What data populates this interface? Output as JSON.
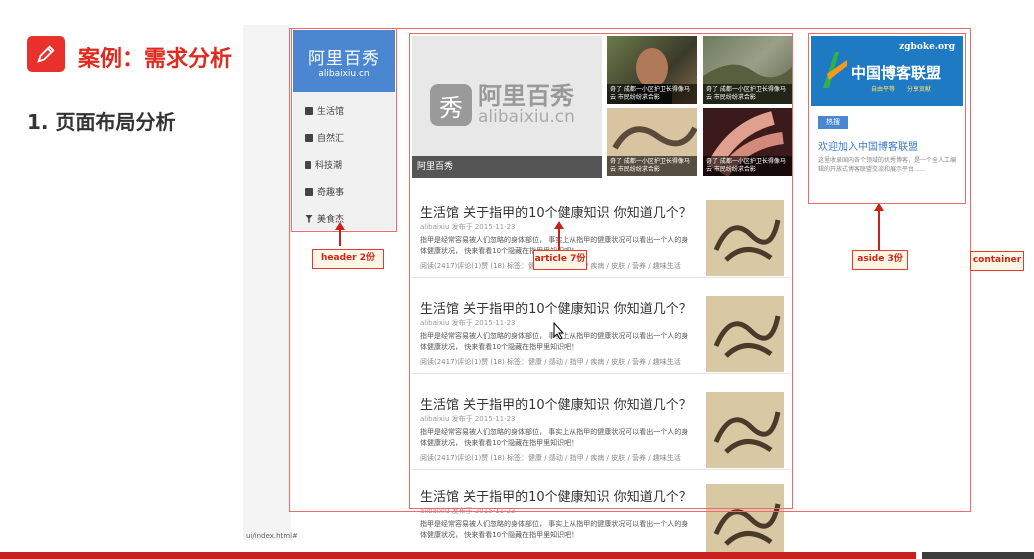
{
  "slide": {
    "case_title": "案例：需求分析",
    "sub_title": "1. 页面布局分析",
    "status_url": "ui/index.html#"
  },
  "colors": {
    "brand_red": "#c8211b",
    "frame_red": "#ef6a6a",
    "header_blue": "#4a87d0"
  },
  "header": {
    "logo_cn": "阿里百秀",
    "logo_en": "alibaixiu.cn",
    "nav": [
      {
        "label": "生活馆",
        "icon": "home-icon"
      },
      {
        "label": "自然汇",
        "icon": "image-icon"
      },
      {
        "label": "科技潮",
        "icon": "phone-icon"
      },
      {
        "label": "奇趣事",
        "icon": "grid-icon"
      },
      {
        "label": "美食杰",
        "icon": "cup-icon"
      }
    ]
  },
  "banner": {
    "mark": "秀",
    "name_cn": "阿里百秀",
    "name_en": "alibaixiu.cn",
    "caption": "阿里百秀"
  },
  "thumbs": [
    "奇了 成都一小区护卫长得像马云 市民纷纷求合影",
    "奇了 成都一小区护卫长得像马云 市民纷纷求合影",
    "奇了 成都一小区护卫长得像马云 市民纷纷求合影",
    "奇了 成都一小区护卫长得像马云 市民纷纷求合影"
  ],
  "articles": [
    {
      "title": "生活馆 关于指甲的10个健康知识 你知道几个？",
      "meta": "alibaixiu 发布于 2015-11-23",
      "desc": "指甲是经常容易被人们忽略的身体部位， 事实上从指甲的健康状况可以看出一个人的身体健康状况， 快来看看10个隐藏在指甲里知识吧！",
      "foot": "阅读(2417)评论(1)赞 (18) 标签：健康 / 感动 / 指甲 / 疾病 / 皮肤 / 营养 / 趣味生活"
    },
    {
      "title": "生活馆 关于指甲的10个健康知识 你知道几个？",
      "meta": "alibaixiu 发布于 2015-11-23",
      "desc": "指甲是经常容易被人们忽略的身体部位， 事实上从指甲的健康状况可以看出一个人的身体健康状况， 快来看看10个隐藏在指甲里知识吧！",
      "foot": "阅读(2417)评论(1)赞 (18) 标签：健康 / 感动 / 指甲 / 疾病 / 皮肤 / 营养 / 趣味生活"
    },
    {
      "title": "生活馆 关于指甲的10个健康知识 你知道几个？",
      "meta": "alibaixiu 发布于 2015-11-23",
      "desc": "指甲是经常容易被人们忽略的身体部位， 事实上从指甲的健康状况可以看出一个人的身体健康状况， 快来看看10个隐藏在指甲里知识吧！",
      "foot": "阅读(2417)评论(1)赞 (18) 标签：健康 / 感动 / 指甲 / 疾病 / 皮肤 / 营养 / 趣味生活"
    },
    {
      "title": "生活馆 关于指甲的10个健康知识 你知道几个？",
      "meta": "alibaixiu 发布于 2015-11-23",
      "desc": "指甲是经常容易被人们忽略的身体部位， 事实上从指甲的健康状况可以看出一个人的身体健康状况， 快来看看10个隐藏在指甲里知识吧！",
      "foot": ""
    }
  ],
  "aside": {
    "ad_site": "zgboke.org",
    "ad_name": "中国博客联盟",
    "ad_slogan": "自由平等 分享贡献",
    "hot_tab": "热搜",
    "join_title": "欢迎加入中国博客联盟",
    "join_desc": "这里收录国内各个领域的优秀博客，是一个全人工编辑的开放式博客联盟交流和展示平台……"
  },
  "labels": {
    "header": "header 2份",
    "article": "article 7份",
    "aside": "aside 3份",
    "container": "container"
  }
}
